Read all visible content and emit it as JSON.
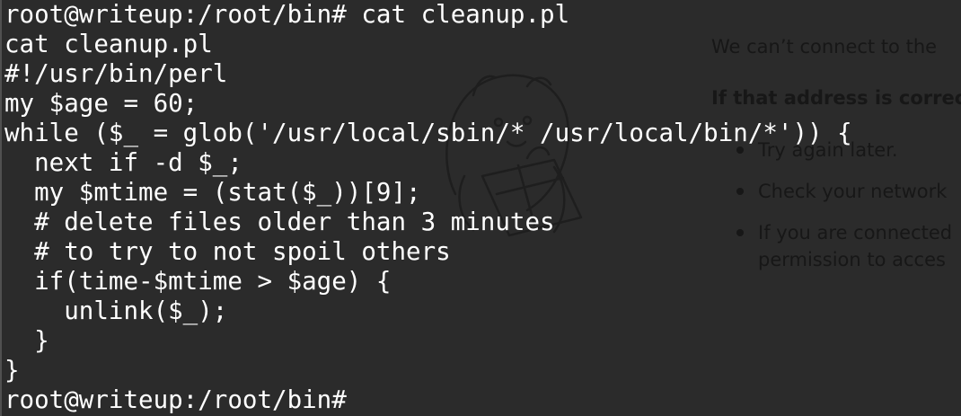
{
  "background_page": {
    "title": "We can’t connect to the",
    "subtitle": "If that address is correct",
    "bullets": [
      "Try again later.",
      "Check your network",
      "If you are connected",
      "permission to acces"
    ]
  },
  "terminal": {
    "lines": [
      "root@writeup:/root/bin# cat cleanup.pl",
      "cat cleanup.pl",
      "#!/usr/bin/perl",
      "my $age = 60;",
      "while ($_ = glob('/usr/local/sbin/* /usr/local/bin/*')) {",
      "  next if -d $_;",
      "  my $mtime = (stat($_))[9];",
      "  # delete files older than 3 minutes",
      "  # to try to not spoil others",
      "  if(time-$mtime > $age) {",
      "    unlink($_);",
      "  }",
      "}",
      "root@writeup:/root/bin# "
    ]
  },
  "icons": {
    "mascot": "dinosaur-mascot-icon"
  }
}
